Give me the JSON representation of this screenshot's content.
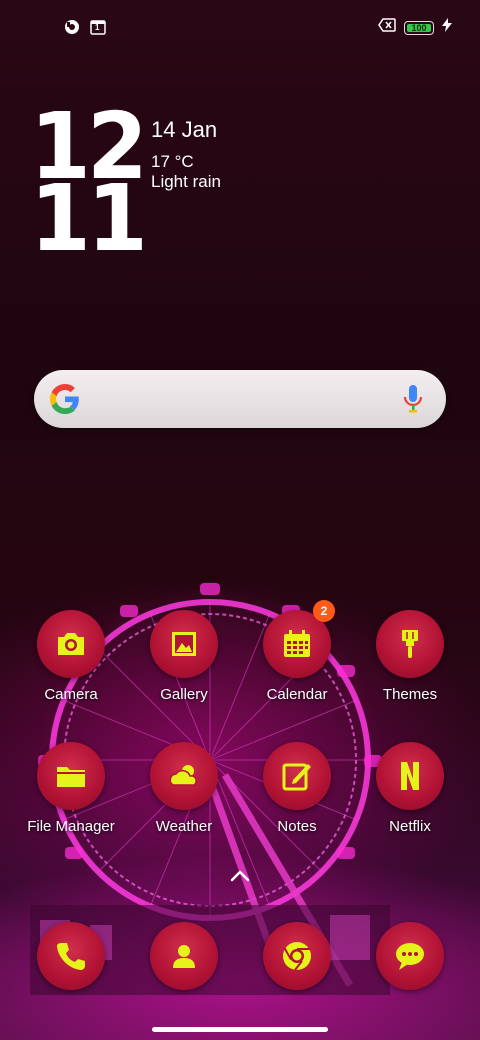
{
  "status_bar": {
    "left_icons": [
      "app-notification-icon",
      "calendar-notification-icon"
    ],
    "calendar_notification_text": "1",
    "right_icons": [
      "no-sim-icon",
      "battery-icon",
      "charging-icon"
    ],
    "battery_level": "100"
  },
  "clock": {
    "hours": "12",
    "minutes": "11"
  },
  "date": "14 Jan",
  "weather": {
    "temp": "17 °C",
    "condition": "Light rain"
  },
  "search": {
    "icons": [
      "google-logo",
      "mic-icon"
    ],
    "accent_colors": {
      "blue": "#4285F4",
      "red": "#EA4335",
      "yellow": "#FBBC05",
      "green": "#34A853"
    }
  },
  "apps": [
    {
      "label": "Camera",
      "icon": "camera-icon"
    },
    {
      "label": "Gallery",
      "icon": "gallery-icon"
    },
    {
      "label": "Calendar",
      "icon": "calendar-icon",
      "badge": "2"
    },
    {
      "label": "Themes",
      "icon": "paintbrush-icon"
    },
    {
      "label": "File Manager",
      "icon": "folder-icon"
    },
    {
      "label": "Weather",
      "icon": "weather-icon"
    },
    {
      "label": "Notes",
      "icon": "notes-icon"
    },
    {
      "label": "Netflix",
      "icon": "netflix-icon"
    }
  ],
  "dock": [
    {
      "icon": "phone-icon"
    },
    {
      "icon": "contacts-icon"
    },
    {
      "icon": "chrome-icon"
    },
    {
      "icon": "messages-icon"
    }
  ],
  "theme": {
    "icon_bg": "#b31335",
    "icon_glyph": "#e6f31a",
    "badge": "#ff5a18"
  }
}
